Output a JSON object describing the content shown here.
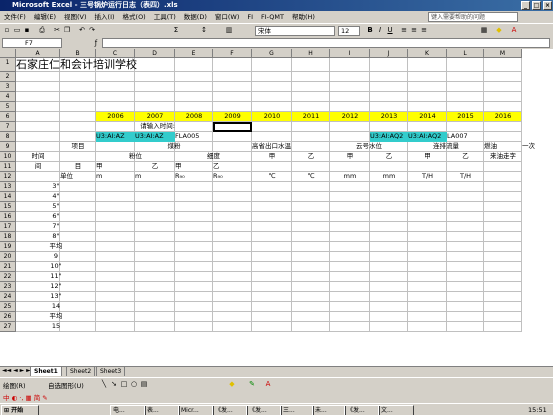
{
  "window": {
    "title": "Microsoft Excel - 三号锅炉运行日志（表四）.xls"
  },
  "menu": [
    "文件(F)",
    "编辑(E)",
    "视图(V)",
    "插入(I)",
    "格式(O)",
    "工具(T)",
    "数据(D)",
    "窗口(W)",
    "FI",
    "FI-QMT",
    "帮助(H)"
  ],
  "help_box_placeholder": "键入需要帮助的问题",
  "font": {
    "name": "宋体",
    "size": "12"
  },
  "name_box": "F7",
  "columns": [
    "A",
    "B",
    "C",
    "D",
    "E",
    "F",
    "G",
    "H",
    "I",
    "J",
    "K",
    "L",
    "M"
  ],
  "rows": [
    "1",
    "2",
    "3",
    "4",
    "5",
    "6",
    "7",
    "8",
    "9",
    "10",
    "11",
    "12",
    "13",
    "14",
    "15",
    "16",
    "17",
    "18",
    "19",
    "20",
    "21",
    "22",
    "23",
    "24",
    "25",
    "26",
    "27"
  ],
  "sheet": {
    "title": "石家庄仁和会计培训学校",
    "years": [
      "2006",
      "2007",
      "2008",
      "2009",
      "2010",
      "2011",
      "2012",
      "2013",
      "2014",
      "2015",
      "2016"
    ],
    "prompt": "请输入时间:",
    "codes": [
      "U3:AI:AZ",
      "U3:AI:AZ",
      "FLA005",
      "U3:AI:AQ2",
      "U3:AI:AQ2",
      "LA007"
    ],
    "headers": {
      "time": "时间",
      "item": "项目",
      "coal": "煤粉",
      "fine_coal": "粉位",
      "fineness": "细度",
      "outlet_temp": "高省出口水温",
      "cloud_level": "云号水位",
      "feed": "连排流量",
      "fuel": "燃油",
      "first": "一次",
      "a": "甲",
      "b": "乙",
      "unit": "单位",
      "oil_meter": "来油走字"
    },
    "units": [
      "m",
      "m",
      "R₉₀",
      "R₉₀",
      "℃",
      "℃",
      "mm",
      "mm",
      "T/H",
      "T/H"
    ],
    "time_rows": [
      "3\"",
      "4\"",
      "5\"",
      "6\"",
      "7\"",
      "8\"",
      "平均",
      "9",
      "10\"",
      "11\"",
      "12\"",
      "13\"",
      "14",
      "平均",
      "15"
    ]
  },
  "sheet_tabs": [
    "Sheet1",
    "Sheet2",
    "Sheet3"
  ],
  "drawing_label": "绘图(R)",
  "autoshape_label": "自选图形(U)",
  "taskbar": {
    "start": "开始",
    "tasks": [
      "电...",
      "表...",
      "Micr...",
      "《发...",
      "《发...",
      "三...",
      "未...",
      "《发...",
      "文..."
    ],
    "clock": "15:51"
  }
}
